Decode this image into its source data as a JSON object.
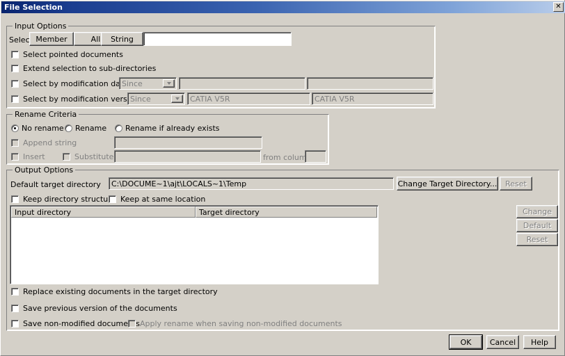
{
  "window": {
    "title": "File Selection",
    "close_icon": "close-icon",
    "close_glyph": "✕"
  },
  "input_options": {
    "legend": "Input Options",
    "select_label": "Select",
    "buttons": [
      {
        "label": "Member"
      },
      {
        "label": "All"
      },
      {
        "label": "String"
      }
    ],
    "select_value": "",
    "checkboxes": [
      {
        "label": "Select pointed documents",
        "checked": false,
        "enabled": true
      },
      {
        "label": "Extend selection to sub-directories",
        "checked": false,
        "enabled": true
      },
      {
        "label": "Select by modification date",
        "checked": false,
        "enabled": true
      },
      {
        "label": "Select by modification version",
        "checked": false,
        "enabled": true
      }
    ],
    "date_row": {
      "combo_value": "Since",
      "field1_value": "",
      "field2_value": ""
    },
    "version_row": {
      "combo_value": "Since",
      "field1_value": "CATIA V5R",
      "field2_value": "CATIA V5R"
    }
  },
  "rename_criteria": {
    "legend": "Rename Criteria",
    "radios": [
      {
        "label": "No rename",
        "selected": true
      },
      {
        "label": "Rename",
        "selected": false
      },
      {
        "label": "Rename if already exists",
        "selected": false
      }
    ],
    "append_string": {
      "label": "Append string",
      "checked": false,
      "enabled": false,
      "value": ""
    },
    "insert": {
      "label": "Insert",
      "checked": false,
      "enabled": false
    },
    "substitute": {
      "label": "Substitute",
      "checked": false,
      "enabled": false,
      "value": ""
    },
    "from_column": {
      "label": "from column",
      "value": "",
      "enabled": false
    }
  },
  "output_options": {
    "legend": "Output Options",
    "default_target_dir_label": "Default target directory",
    "default_target_dir_value": "C:\\DOCUME~1\\ajt\\LOCALS~1\\Temp",
    "change_target_dir_button": "Change Target Directory...",
    "reset_top_button": "Reset",
    "keep_directory_structure": {
      "label": "Keep directory structure",
      "checked": false
    },
    "keep_at_same_location": {
      "label": "Keep at same location",
      "checked": false
    },
    "table": {
      "columns": [
        "Input directory",
        "Target directory"
      ],
      "rows": []
    },
    "side_buttons": [
      {
        "label": "Change",
        "enabled": false
      },
      {
        "label": "Default",
        "enabled": false
      },
      {
        "label": "Reset",
        "enabled": false
      }
    ],
    "bottom_checkboxes": [
      {
        "label": "Replace existing documents in the target directory",
        "checked": false,
        "enabled": true
      },
      {
        "label": "Save previous version of the documents",
        "checked": false,
        "enabled": true
      },
      {
        "label": "Save non-modified documents",
        "checked": false,
        "enabled": true
      },
      {
        "label": "Apply rename when saving non-modified documents",
        "checked": false,
        "enabled": false
      }
    ]
  },
  "footer": {
    "ok": "OK",
    "cancel": "Cancel",
    "help": "Help"
  },
  "colors": {
    "dialog_face": "#d4d0c8",
    "title_start": "#09246e",
    "title_end": "#b9cdea",
    "disabled_text": "#808080"
  }
}
